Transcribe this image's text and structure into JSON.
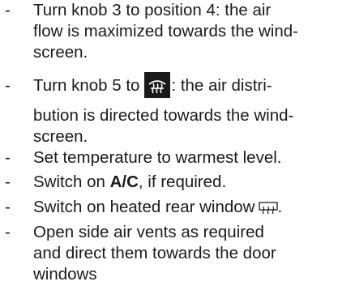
{
  "instructions": [
    {
      "dash": "-",
      "lines": [
        "Turn knob 3 to position 4: the air",
        "flow is maximized towards the wind-",
        "screen."
      ]
    },
    {
      "dash": "-",
      "before_icon": "Turn knob 5 to",
      "icon": "windscreen-defrost-icon",
      "after_icon": ": the air distri-",
      "lines": [
        "bution is directed towards the wind-",
        "screen."
      ]
    },
    {
      "dash": "-",
      "lines": [
        "Set temperature to warmest level."
      ]
    },
    {
      "dash": "-",
      "before_bold": "Switch on ",
      "bold": "A/C",
      "after_bold": ", if required."
    },
    {
      "dash": "-",
      "before_icon": "Switch on heated rear window",
      "icon": "rear-window-heating-icon",
      "after_icon": "."
    },
    {
      "dash": "-",
      "lines": [
        "Open side air vents as required",
        "and direct them towards the door",
        "windows"
      ]
    }
  ]
}
